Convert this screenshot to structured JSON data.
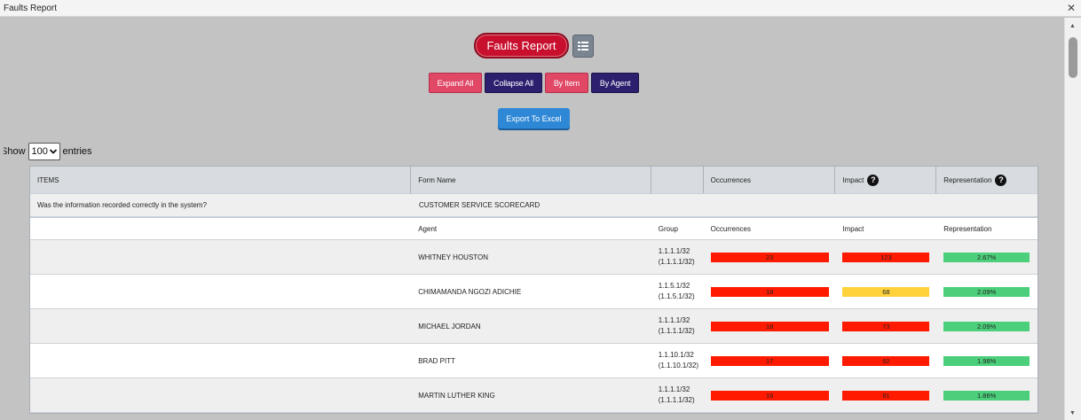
{
  "window": {
    "title": "Faults Report",
    "close_glyph": "✕"
  },
  "header": {
    "report_label": "Faults Report",
    "list_icon": "list-icon"
  },
  "buttons": {
    "expand_all": "Expand All",
    "collapse_all": "Collapse All",
    "by_item": "By Item",
    "by_agent": "By Agent",
    "export": "Export To Excel"
  },
  "entries": {
    "show": "Show",
    "value": "100",
    "suffix": "entries"
  },
  "table": {
    "headers": {
      "items": "ITEMS",
      "form_name": "Form Name",
      "group": "",
      "occurrences": "Occurrences",
      "impact": "Impact",
      "representation": "Representation",
      "help": "?"
    },
    "item": {
      "question": "Was the information recorded correctly in the system?",
      "form": "CUSTOMER SERVICE SCORECARD"
    },
    "subheaders": {
      "agent": "Agent",
      "group": "Group",
      "occurrences": "Occurrences",
      "impact": "Impact",
      "representation": "Representation"
    },
    "rows": [
      {
        "agent": "WHITNEY HOUSTON",
        "group1": "1.1.1.1/32",
        "group2": "(1.1.1.1/32)",
        "occ": "23",
        "imp": "123",
        "rep": "2.67%",
        "imp_color": "#ff1a00"
      },
      {
        "agent": "CHIMAMANDA NGOZI ADICHIE",
        "group1": "1.1.5.1/32",
        "group2": "(1.1.5.1/32)",
        "occ": "18",
        "imp": "68",
        "rep": "2.09%",
        "imp_color": "#ffd23c"
      },
      {
        "agent": "MICHAEL JORDAN",
        "group1": "1.1.1.1/32",
        "group2": "(1.1.1.1/32)",
        "occ": "18",
        "imp": "73",
        "rep": "2.09%",
        "imp_color": "#ff1a00"
      },
      {
        "agent": "BRAD PITT",
        "group1": "1.1.10.1/32",
        "group2": "(1.1.10.1/32)",
        "occ": "17",
        "imp": "92",
        "rep": "1.98%",
        "imp_color": "#ff1a00"
      },
      {
        "agent": "MARTIN LUTHER KING",
        "group1": "1.1.1.1/32",
        "group2": "(1.1.1.1/32)",
        "occ": "16",
        "imp": "91",
        "rep": "1.86%",
        "imp_color": "#ff1a00"
      }
    ]
  },
  "colors": {
    "occurrence_bar": "#ff1a00",
    "representation_bar": "#4ccf7a",
    "report_pill": "#c8102e",
    "navy_button": "#2c1f6e",
    "pink_button": "#e04866",
    "export_button": "#2f88d6"
  }
}
